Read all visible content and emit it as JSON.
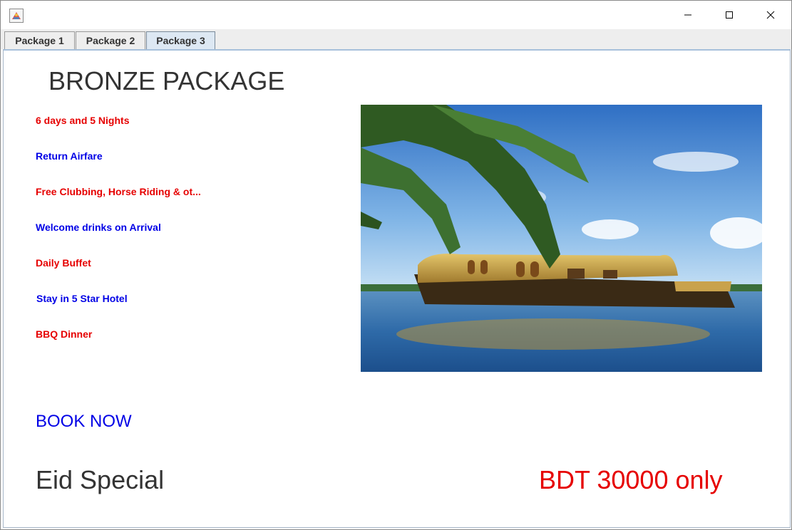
{
  "window": {
    "icon": "java-app-icon",
    "controls": {
      "minimize_icon": "minimize-icon",
      "maximize_icon": "maximize-icon",
      "close_icon": "close-icon"
    }
  },
  "tabs": [
    {
      "label": "Package 1",
      "active": false
    },
    {
      "label": "Package 2",
      "active": false
    },
    {
      "label": "Package 3",
      "active": true
    }
  ],
  "package": {
    "title": "BRONZE PACKAGE",
    "features": [
      {
        "text": "6 days and 5 Nights",
        "color": "#e60000"
      },
      {
        "text": "Return Airfare",
        "color": "#0000e6"
      },
      {
        "text": "Free Clubbing, Horse Riding & ot...",
        "color": "#e60000"
      },
      {
        "text": "Welcome drinks on Arrival",
        "color": "#0000e6"
      },
      {
        "text": "Daily Buffet",
        "color": "#e60000"
      },
      {
        "text": "Stay in 5 Star Hotel",
        "color": "#0000e6"
      },
      {
        "text": "BBQ Dinner",
        "color": "#e60000"
      }
    ],
    "book_label": "BOOK NOW",
    "book_color": "#0000e6",
    "offer": "Eid Special",
    "price": "BDT 30000 only",
    "price_color": "#e60000",
    "image": "houseboat-palm-photo"
  }
}
